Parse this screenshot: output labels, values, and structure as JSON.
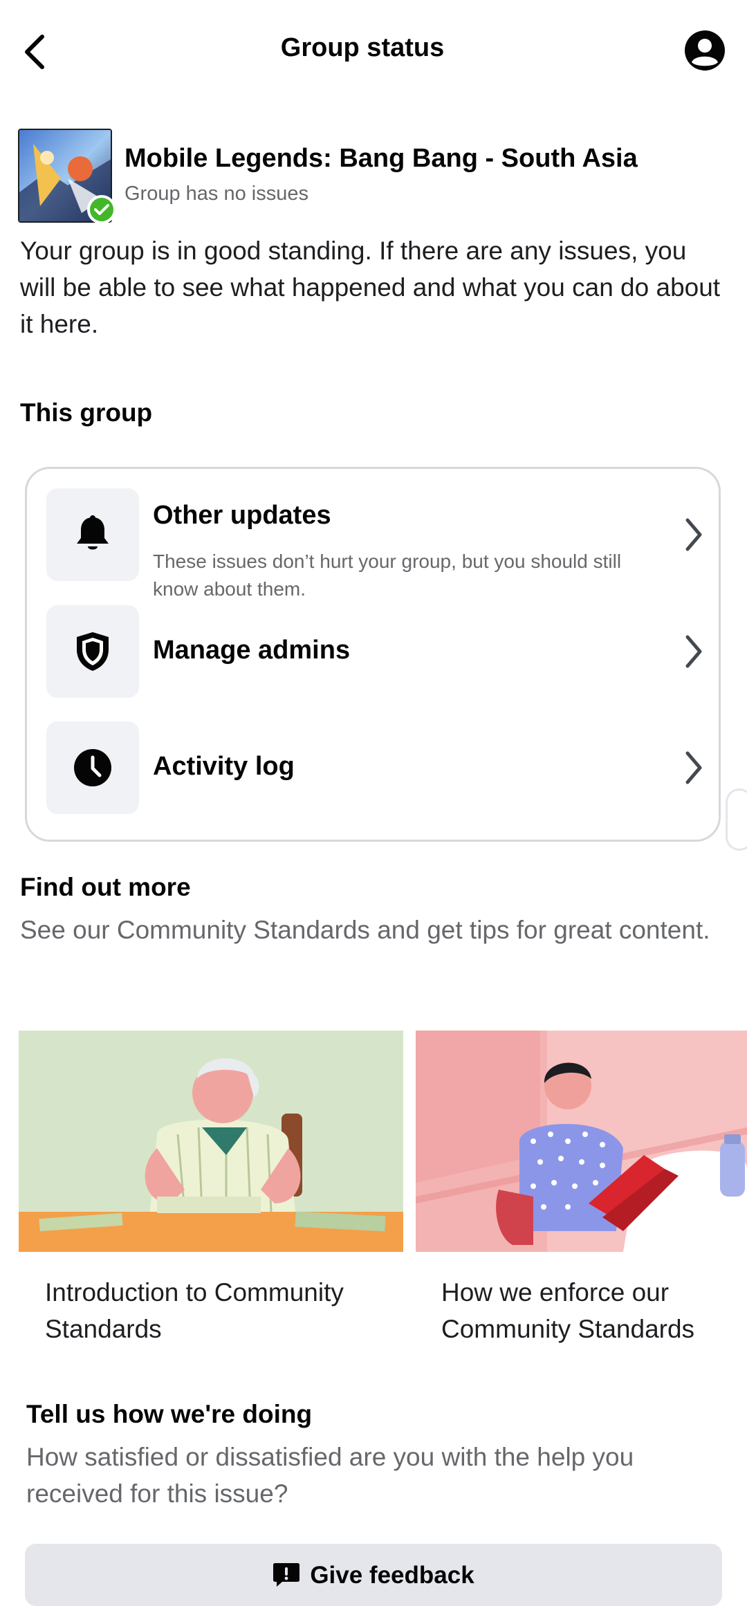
{
  "header": {
    "title": "Group status",
    "back_icon": "chevron-left-icon",
    "profile_icon": "account-circle-icon"
  },
  "group": {
    "name": "Mobile Legends: Bang Bang - South Asia",
    "status": "Group has no issues",
    "status_color": "#42b72a",
    "description": "Your group is in good standing. If there are any issues, you will be able to see what happened and what you can do about it here."
  },
  "this_group": {
    "title": "This group",
    "items": [
      {
        "title": "Other updates",
        "description": "These issues don’t hurt your group, but you should still know about them.",
        "icon": "bell-icon"
      },
      {
        "title": "Manage admins",
        "icon": "shield-icon"
      },
      {
        "title": "Activity log",
        "icon": "clock-icon"
      }
    ]
  },
  "find_out_more": {
    "title": "Find out more",
    "subtitle": "See our Community Standards and get tips for great content.",
    "articles": [
      {
        "title": "Introduction to Community Standards"
      },
      {
        "title": "How we enforce our Community Standards"
      }
    ]
  },
  "feedback": {
    "title": "Tell us how we're doing",
    "subtitle": "How satisfied or dissatisfied are you with the help you received for this issue?",
    "button_label": "Give feedback",
    "button_icon": "feedback-icon"
  }
}
